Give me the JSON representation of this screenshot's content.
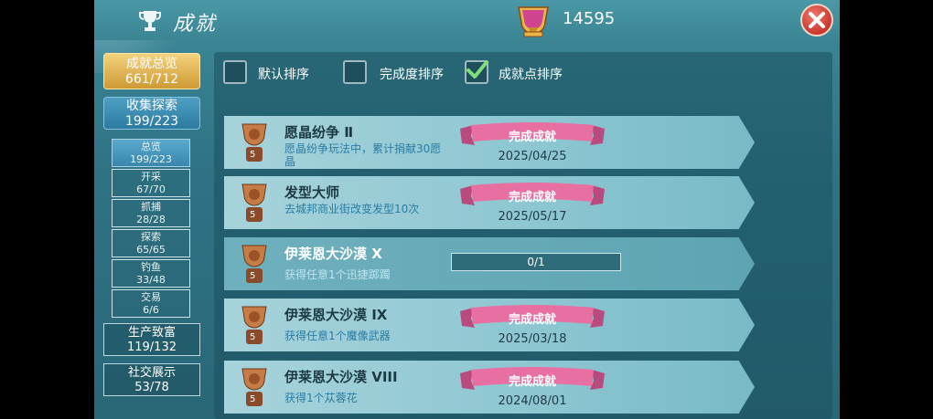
{
  "header": {
    "title": "成就",
    "score": "14595"
  },
  "sidebar": {
    "overview": {
      "label": "成就总览",
      "count": "661/712"
    },
    "collect": {
      "label": "收集探索",
      "count": "199/223"
    },
    "subitems": [
      {
        "label": "总览",
        "count": "199/223",
        "selected": true
      },
      {
        "label": "开采",
        "count": "67/70",
        "selected": false
      },
      {
        "label": "抓捕",
        "count": "28/28",
        "selected": false
      },
      {
        "label": "探索",
        "count": "65/65",
        "selected": false
      },
      {
        "label": "钓鱼",
        "count": "33/48",
        "selected": false
      },
      {
        "label": "交易",
        "count": "6/6",
        "selected": false
      }
    ],
    "production": {
      "label": "生产致富",
      "count": "119/132"
    },
    "social": {
      "label": "社交展示",
      "count": "53/78"
    }
  },
  "sort": {
    "default_label": "默认排序",
    "default_checked": false,
    "completion_label": "完成度排序",
    "completion_checked": false,
    "points_label": "成就点排序",
    "points_checked": true
  },
  "achievements": [
    {
      "name": "愿晶纷争 Ⅱ",
      "desc": "愿晶纷争玩法中，累计捐献30愿晶",
      "status": "完成成就",
      "date": "2025/04/25",
      "medal_level": "5",
      "completed": true
    },
    {
      "name": "发型大师",
      "desc": "去城邦商业街改变发型10次",
      "status": "完成成就",
      "date": "2025/05/17",
      "medal_level": "5",
      "completed": true
    },
    {
      "name": "伊莱恩大沙漠 X",
      "desc": "获得任意1个迅捷踯躅",
      "progress": "0/1",
      "medal_level": "5",
      "completed": false
    },
    {
      "name": "伊莱恩大沙漠 IX",
      "desc": "获得任意1个魔像武器",
      "status": "完成成就",
      "date": "2025/03/18",
      "medal_level": "5",
      "completed": true
    },
    {
      "name": "伊莱恩大沙漠 VIII",
      "desc": "获得1个苁蓉花",
      "status": "完成成就",
      "date": "2024/08/01",
      "medal_level": "5",
      "completed": true
    }
  ],
  "colors": {
    "ribbon": "#e86fa1",
    "gold": "#cf9a35",
    "close": "#c8372c"
  }
}
